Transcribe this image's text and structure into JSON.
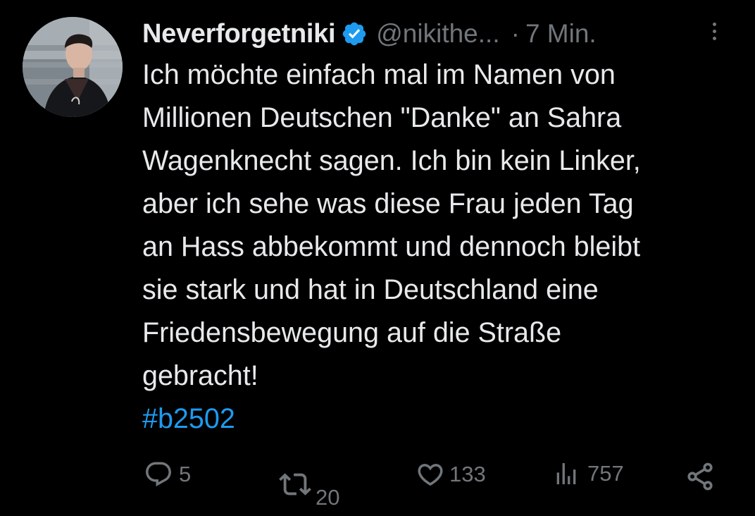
{
  "tweet": {
    "author": {
      "display_name": "Neverforgetniki",
      "handle": "@nikithe...",
      "verified": true
    },
    "separator": "·",
    "time": "7 Min.",
    "text_lines": [
      "Ich möchte einfach mal im Namen von",
      "Millionen Deutschen \"Danke\" an Sahra",
      "Wagenknecht sagen. Ich bin kein Linker,",
      "aber ich sehe was diese Frau jeden Tag",
      "an Hass abbekommt und dennoch bleibt",
      "sie stark und hat in Deutschland eine",
      "Friedensbewegung auf die Straße",
      "gebracht!"
    ],
    "hashtag": "#b2502"
  },
  "actions": {
    "reply_count": "5",
    "retweet_count": "20",
    "like_count": "133",
    "views_count": "757"
  },
  "icons": {
    "verified": "verified-badge-icon",
    "more": "more-options-icon",
    "reply": "reply-icon",
    "retweet": "retweet-icon",
    "like": "heart-icon",
    "views": "views-chart-icon",
    "share": "share-icon"
  },
  "colors": {
    "background": "#000000",
    "text_primary": "#e7e9ea",
    "text_secondary": "#71767b",
    "accent": "#1d9bf0"
  }
}
